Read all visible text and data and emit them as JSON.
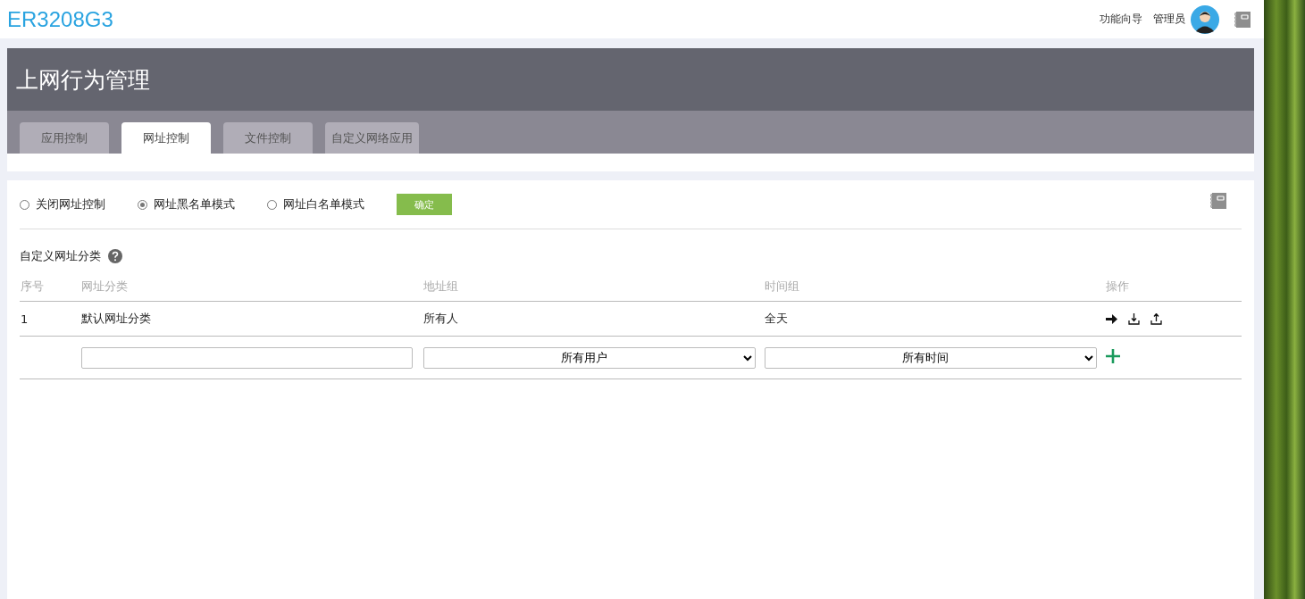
{
  "header": {
    "logo": "ER3208G3",
    "wizard_link": "功能向导",
    "user_name": "管理员"
  },
  "page_title": "上网行为管理",
  "tabs": [
    {
      "label": "应用控制",
      "selected": false
    },
    {
      "label": "网址控制",
      "selected": true
    },
    {
      "label": "文件控制",
      "selected": false
    },
    {
      "label": "自定义网络应用",
      "selected": false
    }
  ],
  "modes": [
    {
      "label": "关闭网址控制",
      "selected": false
    },
    {
      "label": "网址黑名单模式",
      "selected": true
    },
    {
      "label": "网址白名单模式",
      "selected": false
    }
  ],
  "confirm_button": "确定",
  "section_title": "自定义网址分类",
  "table": {
    "columns": [
      "序号",
      "网址分类",
      "地址组",
      "时间组",
      "操作"
    ],
    "rows": [
      {
        "index": "1",
        "category": "默认网址分类",
        "address_group": "所有人",
        "time_group": "全天"
      }
    ]
  },
  "new_row": {
    "address_group": "所有用户",
    "time_group": "所有时间"
  }
}
